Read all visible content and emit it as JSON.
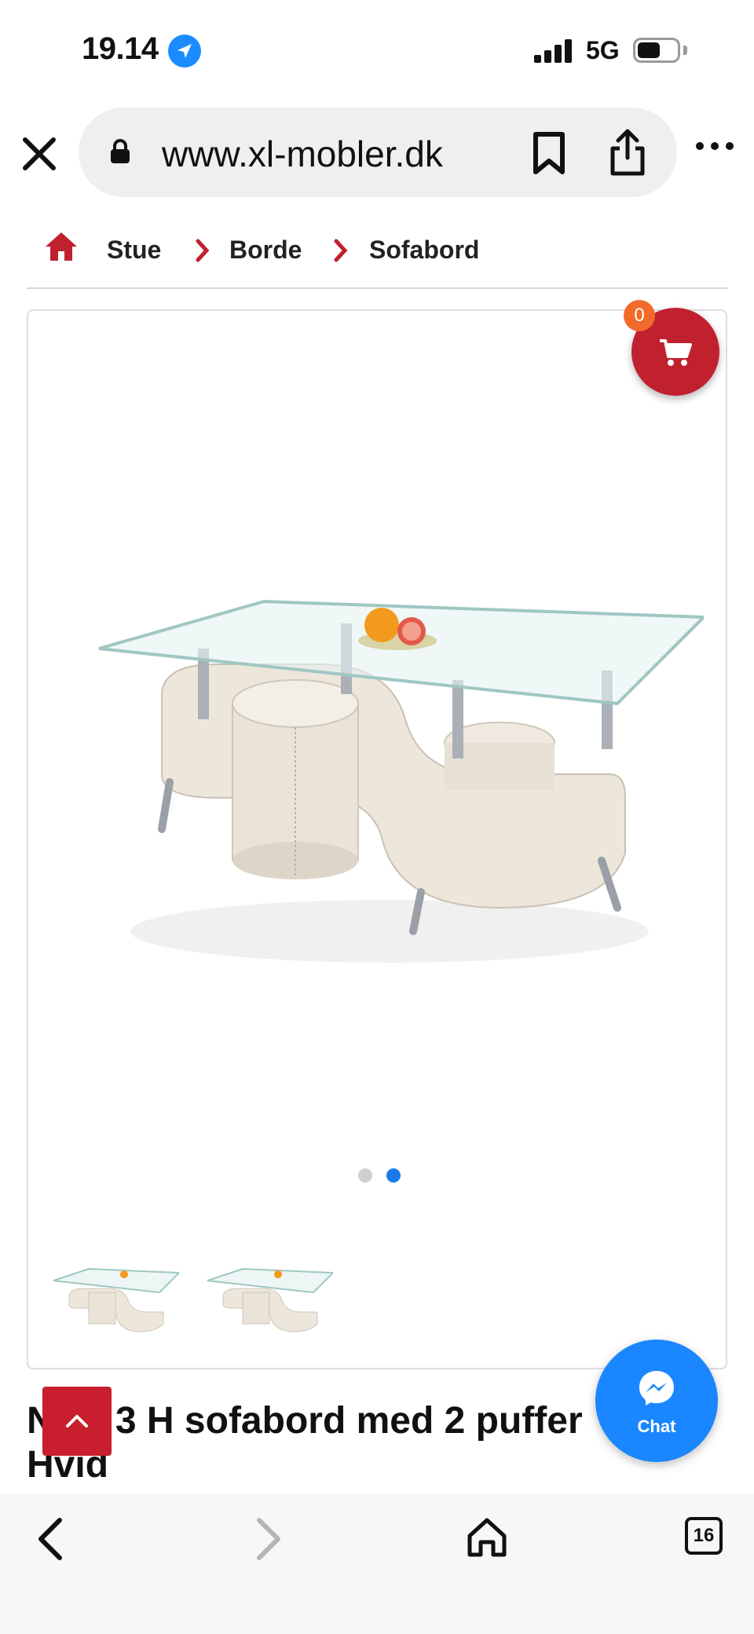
{
  "status_bar": {
    "time": "19.14",
    "network": "5G"
  },
  "browser": {
    "url": "www.xl-mobler.dk"
  },
  "breadcrumb": {
    "items": [
      "Stue",
      "Borde",
      "Sofabord"
    ]
  },
  "cart": {
    "count": "0"
  },
  "gallery": {
    "slide_count": 2,
    "active_slide": 2,
    "thumbnails": 2
  },
  "product": {
    "title": "NEA 3 H sofabord med 2 puffer Hvid"
  },
  "chat": {
    "label": "Chat"
  },
  "toolbar": {
    "tab_count": "16"
  },
  "colors": {
    "brand_red": "#c1202f",
    "chat_blue": "#1a86ff",
    "badge_orange": "#f26b2a"
  }
}
